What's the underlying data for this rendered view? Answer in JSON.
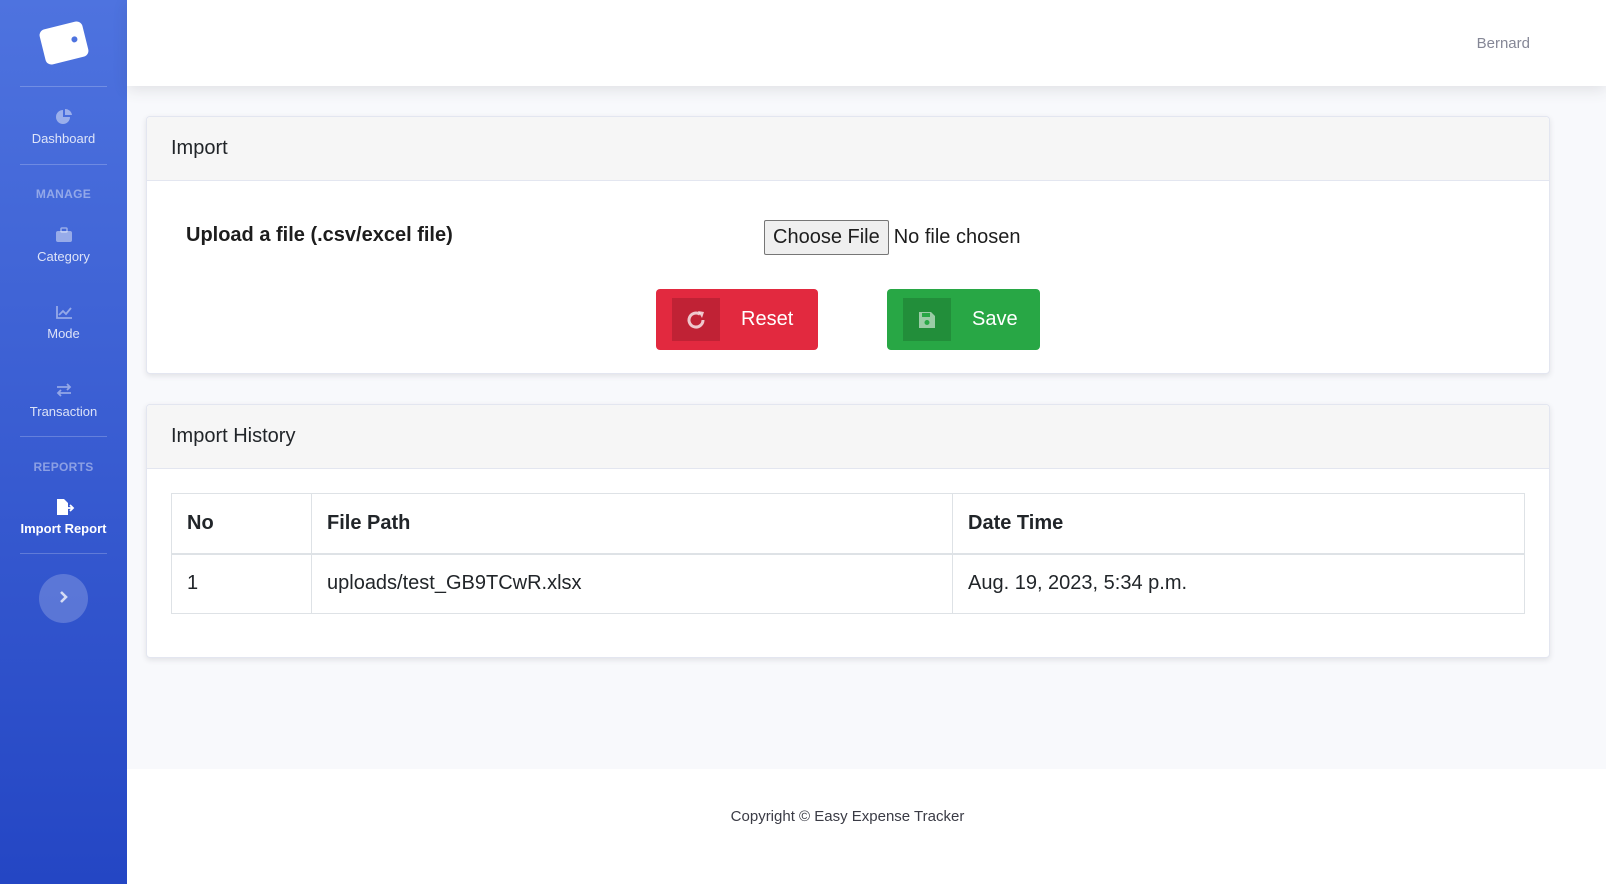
{
  "sidebar": {
    "items": [
      {
        "label": "Dashboard",
        "icon": "pie-chart-icon"
      },
      {
        "label": "Category",
        "icon": "briefcase-icon"
      },
      {
        "label": "Mode",
        "icon": "line-chart-icon"
      },
      {
        "label": "Transaction",
        "icon": "exchange-icon"
      },
      {
        "label": "Import Report",
        "icon": "file-export-icon"
      }
    ],
    "headings": {
      "manage": "MANAGE",
      "reports": "REPORTS"
    },
    "toggler_icon": "chevron-right-icon"
  },
  "topbar": {
    "user": "Bernard"
  },
  "import_card": {
    "title": "Import",
    "upload_label": "Upload a file (.csv/excel file)",
    "choose_file": "Choose File",
    "file_status": "No file chosen",
    "reset_label": "Reset",
    "save_label": "Save"
  },
  "history_card": {
    "title": "Import History",
    "columns": [
      "No",
      "File Path",
      "Date Time"
    ],
    "rows": [
      [
        "1",
        "uploads/test_GB9TCwR.xlsx",
        "Aug. 19, 2023, 5:34 p.m."
      ]
    ]
  },
  "footer": {
    "text": "Copyright © Easy Expense Tracker"
  },
  "colors": {
    "sidebar_top": "#4e73df",
    "sidebar_bottom": "#2446c4",
    "reset": "#e2293f",
    "save": "#28a745"
  }
}
